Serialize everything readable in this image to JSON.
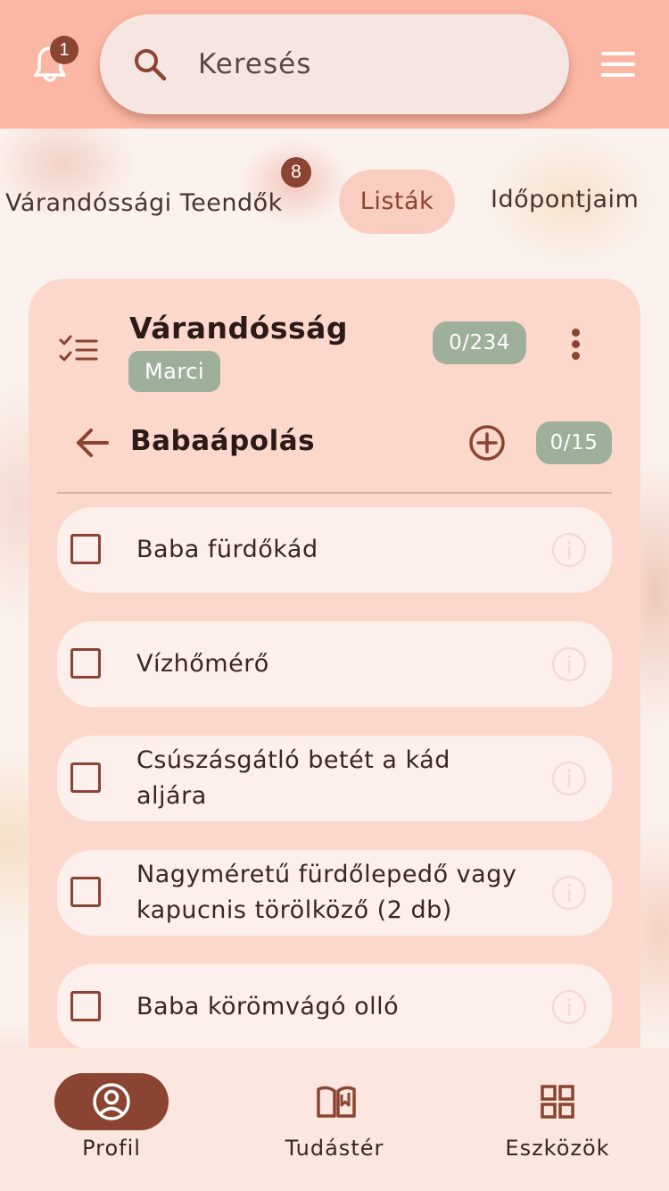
{
  "header": {
    "notification_count": "1",
    "search_placeholder": "Keresés",
    "icons": {
      "bell": "bell-icon",
      "search": "search-icon",
      "menu": "hamburger-menu-icon"
    }
  },
  "tabs": [
    {
      "label": "Várandóssági Teendők",
      "badge": "8"
    },
    {
      "label": "Listák",
      "selected": true
    },
    {
      "label": "Időpontjaim"
    }
  ],
  "card": {
    "title": "Várandósság",
    "owner": "Marci",
    "total_count": "0/234",
    "category": {
      "title": "Babaápolás",
      "count": "0/15"
    },
    "items": [
      {
        "label": "Baba fürdőkád",
        "checked": false
      },
      {
        "label": "Vízhőmérő",
        "checked": false
      },
      {
        "label": "Csúszásgátló betét a kád aljára",
        "checked": false
      },
      {
        "label": "Nagyméretű fürdőlepedő vagy kapucnis törölköző (2 db)",
        "checked": false
      },
      {
        "label": "Baba körömvágó olló",
        "checked": false
      }
    ]
  },
  "bottom_nav": [
    {
      "label": "Profil",
      "icon": "profile-icon",
      "active": true
    },
    {
      "label": "Tudástér",
      "icon": "book-icon",
      "active": false
    },
    {
      "label": "Eszközök",
      "icon": "grid-icon",
      "active": false
    }
  ],
  "colors": {
    "topbar": "#fbb7a3",
    "accent": "#8b4332",
    "chip": "#9eb09a",
    "card": "#fcd8cc"
  }
}
